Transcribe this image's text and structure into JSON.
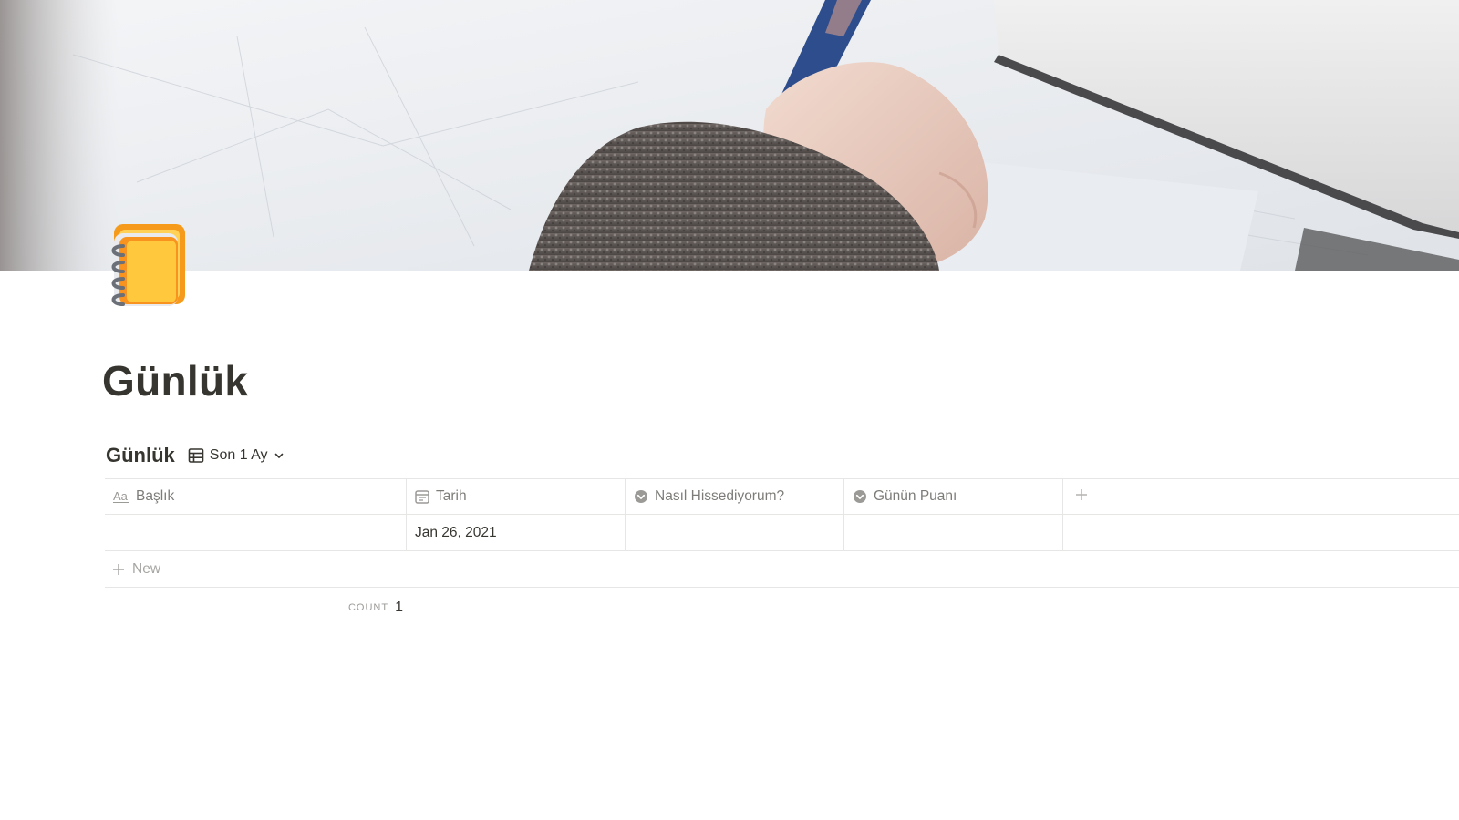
{
  "page": {
    "title": "Günlük",
    "icon": "spiral-notebook-icon"
  },
  "cover": {
    "description_icon": "cover-image"
  },
  "database": {
    "title": "Günlük",
    "view": {
      "icon": "table-icon",
      "label": "Son 1 Ay",
      "dropdown_icon": "chevron-down-icon"
    },
    "columns": [
      {
        "label": "Başlık",
        "icon": "text-aa-icon"
      },
      {
        "label": "Tarih",
        "icon": "calendar-icon"
      },
      {
        "label": "Nasıl Hissediyorum?",
        "icon": "select-icon"
      },
      {
        "label": "Günün Puanı",
        "icon": "select-icon"
      }
    ],
    "add_column_icon": "plus-icon",
    "rows": [
      {
        "baslik": "",
        "tarih": "Jan 26, 2021",
        "nasil": "",
        "puan": ""
      }
    ],
    "new_row_label": "New",
    "calculation": {
      "label": "COUNT",
      "value": "1"
    }
  },
  "colors": {
    "text": "#37352f",
    "muted": "#9b9a97",
    "border": "#e6e6e4",
    "icon_orange": "#f59a1b",
    "icon_yellow": "#ffc83d"
  }
}
